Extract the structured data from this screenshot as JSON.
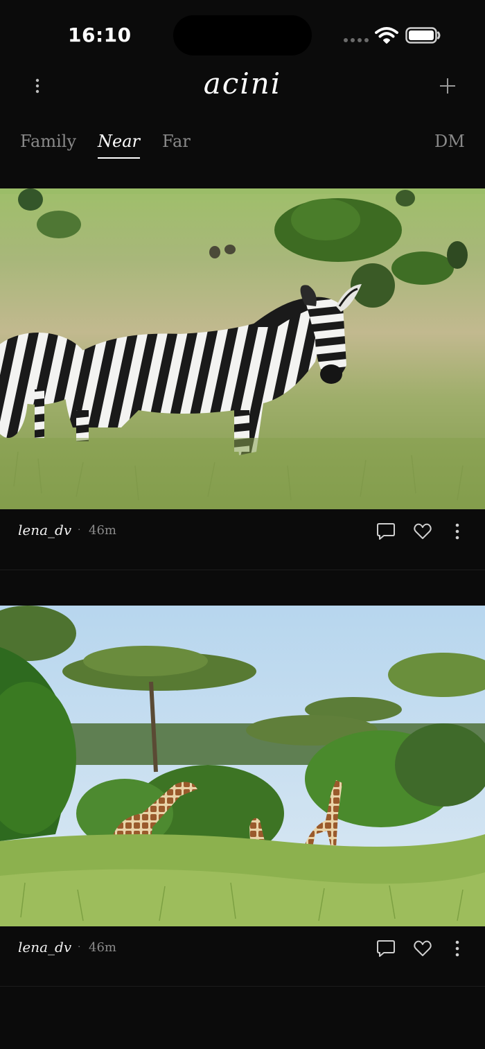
{
  "status_bar": {
    "time": "16:10"
  },
  "app": {
    "title": "acini"
  },
  "tabs": [
    {
      "label": "Family",
      "active": false
    },
    {
      "label": "Near",
      "active": true
    },
    {
      "label": "Far",
      "active": false
    }
  ],
  "dm_label": "DM",
  "posts": [
    {
      "author": "lena_dv",
      "separator": "·",
      "age": "46m",
      "subject": "zebra"
    },
    {
      "author": "lena_dv",
      "separator": "·",
      "age": "46m",
      "subject": "giraffes"
    }
  ],
  "icons": {
    "menu": "vertical-dots-icon",
    "add": "plus-icon",
    "comment": "comment-icon",
    "like": "heart-icon",
    "more": "vertical-dots-icon",
    "wifi": "wifi-icon",
    "battery": "battery-icon",
    "signal": "signal-icon"
  },
  "colors": {
    "background": "#0b0b0b",
    "text": "#f2f2f2",
    "muted": "#8a8a8a"
  }
}
